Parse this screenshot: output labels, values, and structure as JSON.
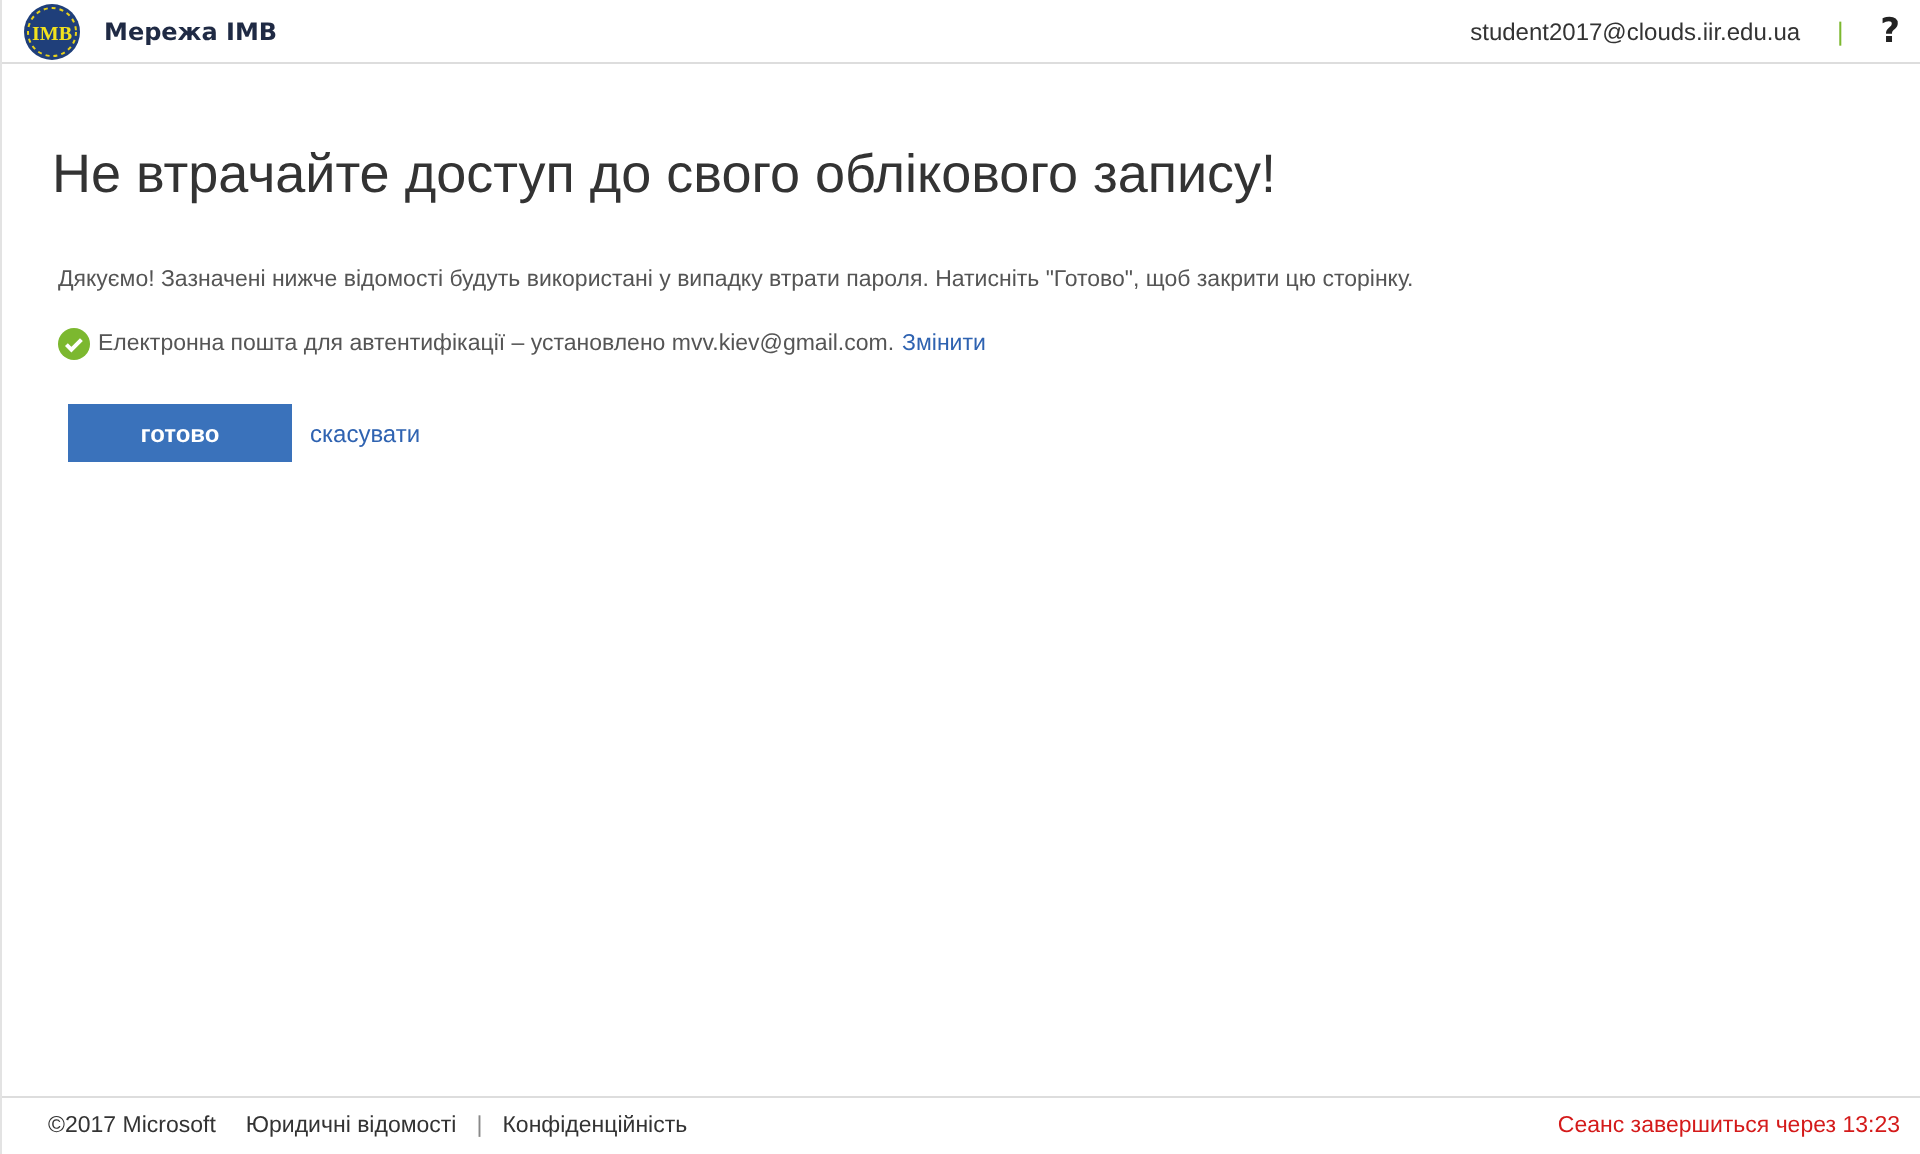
{
  "header": {
    "org_name": "Мережа IMB",
    "logo_text": "IMB",
    "user": "student2017@clouds.iir.edu.ua",
    "separator": "|",
    "help": "?"
  },
  "title": "Не втрачайте доступ до свого облікового запису!",
  "intro": "Дякуємо! Зазначені нижче відомості будуть використані у випадку втрати пароля. Натисніть \"Готово\", щоб закрити цю сторінку.",
  "status": {
    "verified": true,
    "text": "Електронна пошта для автентифікації – установлено mvv.kiev@gmail.com.",
    "link": "Змінити"
  },
  "buttons": {
    "primary": "готово",
    "cancel": "скасувати"
  },
  "footer": {
    "copyright": "©2017 Microsoft",
    "links": [
      "Юридичні відомості",
      "Конфіденційність"
    ],
    "separator": "|",
    "session": "Сеанс завершиться через 13:23"
  }
}
